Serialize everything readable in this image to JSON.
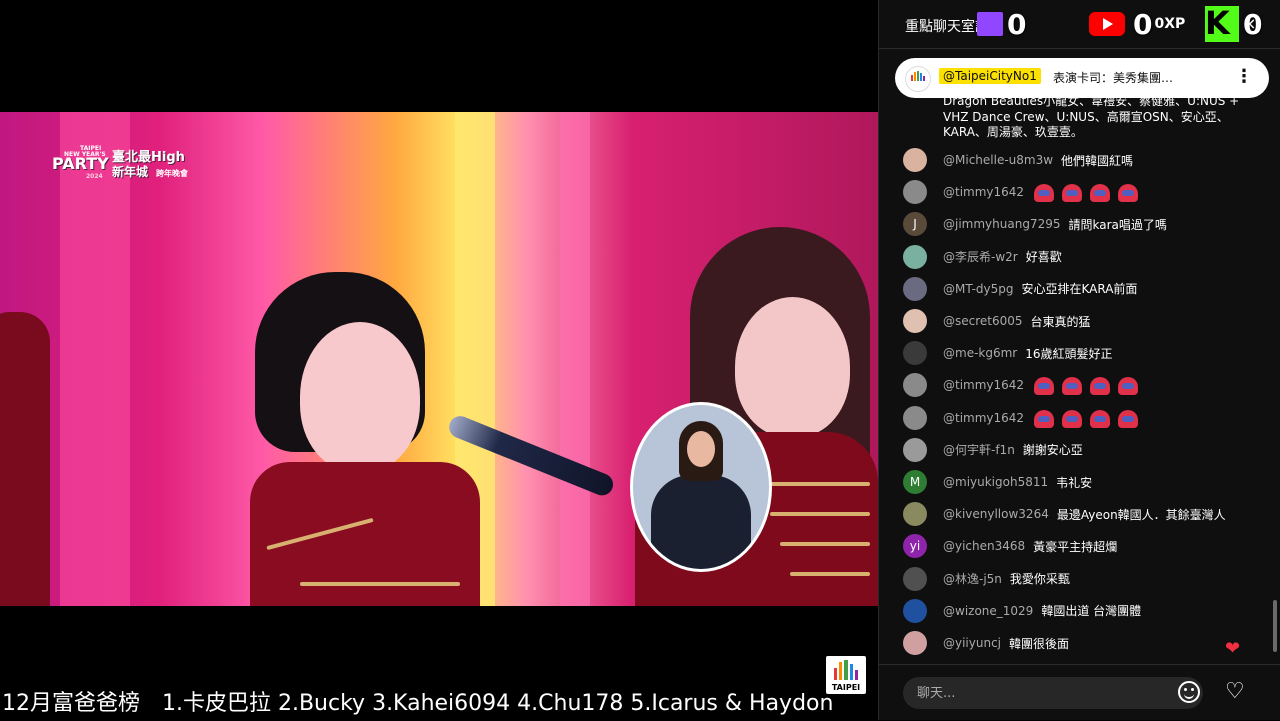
{
  "video": {
    "event_logo_lines": [
      "TAIPEI",
      "NEW YEAR'S",
      "PARTY",
      "2024",
      "臺北最High",
      "新年城",
      "跨年晚會"
    ],
    "broadcaster_logo_text": "TAIPEI",
    "ticker_text": "12月富爸爸榜　1.卡皮巴拉 2.Bucky 3.Kahei6094 4.Chu178 5.Icarus & Haydon"
  },
  "chat": {
    "title": "重點聊天室訊息",
    "counters": {
      "twitch": "0",
      "youtube": "0",
      "xp_label": "0XP",
      "kick": "0"
    },
    "close_icon": "×",
    "pinned": {
      "author": "@TaipeiCityNo1",
      "message": "表演卡司：美秀集團…",
      "more_icon": "⋮",
      "continued_text": "Dragon Beauties小龍女、韋禮安、蔡健雅、U:NUS + VHZ Dance Crew、U:NUS、高爾宣OSN、安心亞、KARA、周湯豪、玖壹壹。"
    },
    "messages": [
      {
        "author": "@Michelle-u8m3w",
        "text": "他們韓國紅嗎",
        "avatar_color": "#d9b3a0",
        "avatar_letter": ""
      },
      {
        "author": "@timmy1642",
        "text": "",
        "emote_count": 4,
        "avatar_color": "#8a8a8a",
        "avatar_letter": ""
      },
      {
        "author": "@jimmyhuang7295",
        "text": "請問kara唱過了嗎",
        "avatar_color": "#5a4a3a",
        "avatar_letter": "J"
      },
      {
        "author": "@李辰希-w2r",
        "text": "好喜歡",
        "avatar_color": "#7ab0a0",
        "avatar_letter": ""
      },
      {
        "author": "@MT-dy5pg",
        "text": "安心亞排在KARA前面",
        "avatar_color": "#6a6a80",
        "avatar_letter": ""
      },
      {
        "author": "@secret6005",
        "text": "台東真的猛",
        "avatar_color": "#e0c0b0",
        "avatar_letter": ""
      },
      {
        "author": "@me-kg6mr",
        "text": "16歲紅頭髮好正",
        "avatar_color": "#3a3a3a",
        "avatar_letter": ""
      },
      {
        "author": "@timmy1642",
        "text": "",
        "emote_count": 4,
        "avatar_color": "#8a8a8a",
        "avatar_letter": ""
      },
      {
        "author": "@timmy1642",
        "text": "",
        "emote_count": 4,
        "avatar_color": "#8a8a8a",
        "avatar_letter": ""
      },
      {
        "author": "@何宇軒-f1n",
        "text": "謝謝安心亞",
        "avatar_color": "#9a9a9a",
        "avatar_letter": ""
      },
      {
        "author": "@miyukigoh5811",
        "text": "韦礼安",
        "avatar_color": "#2e7d32",
        "avatar_letter": "M"
      },
      {
        "author": "@kivenyllow3264",
        "text": "最邊Ayeon韓國人．其餘臺灣人",
        "avatar_color": "#8a8a60",
        "avatar_letter": ""
      },
      {
        "author": "@yichen3468",
        "text": "黃豪平主持超爛",
        "avatar_color": "#8e24aa",
        "avatar_letter": "yi"
      },
      {
        "author": "@林逸-j5n",
        "text": "我愛你采甄",
        "avatar_color": "#505050",
        "avatar_letter": ""
      },
      {
        "author": "@wizone_1029",
        "text": "韓國出道 台灣團體",
        "avatar_color": "#2050a0",
        "avatar_letter": ""
      },
      {
        "author": "@yiiyuncj",
        "text": "韓團很後面",
        "avatar_color": "#d0a0a0",
        "avatar_letter": ""
      }
    ],
    "input_placeholder": "聊天...",
    "floating_heart": "❤",
    "like_icon": "♡"
  }
}
